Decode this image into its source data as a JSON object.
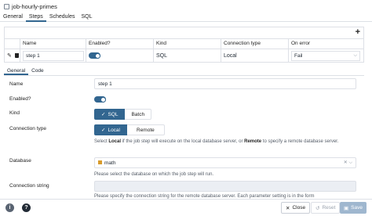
{
  "window": {
    "title": "job-hourly-primes"
  },
  "tabs": [
    {
      "label": "General"
    },
    {
      "label": "Steps"
    },
    {
      "label": "Schedules"
    },
    {
      "label": "SQL"
    }
  ],
  "grid": {
    "add_icon": "plus-icon",
    "headers": [
      "Name",
      "Enabled?",
      "Kind",
      "Connection type",
      "On error"
    ],
    "row": {
      "name": "step 1",
      "enabled": true,
      "kind": "SQL",
      "connection_type": "Local",
      "on_error": "Fail"
    }
  },
  "subtabs": [
    {
      "label": "General"
    },
    {
      "label": "Code"
    }
  ],
  "form": {
    "name_label": "Name",
    "name_value": "step 1",
    "enabled_label": "Enabled?",
    "kind_label": "Kind",
    "kind_options": [
      "SQL",
      "Batch"
    ],
    "kind_selected": "SQL",
    "conn_label": "Connection type",
    "conn_options": [
      "Local",
      "Remote"
    ],
    "conn_selected": "Local",
    "conn_help_1": "Select ",
    "conn_help_local": "Local",
    "conn_help_2": " if the job step will execute on the local database server, or ",
    "conn_help_remote": "Remote",
    "conn_help_3": " to specify a remote database server.",
    "db_label": "Database",
    "db_value": "math",
    "db_help": "Please select the database on which the job step will run.",
    "connstr_label": "Connection string",
    "connstr_help": "Please specify the connection string for the remote database server. Each parameter setting is in the form"
  },
  "footer": {
    "close_label": "Close",
    "reset_label": "Reset",
    "save_label": "Save"
  },
  "colors": {
    "accent": "#326690",
    "save_disabled": "#9fb7cf"
  }
}
